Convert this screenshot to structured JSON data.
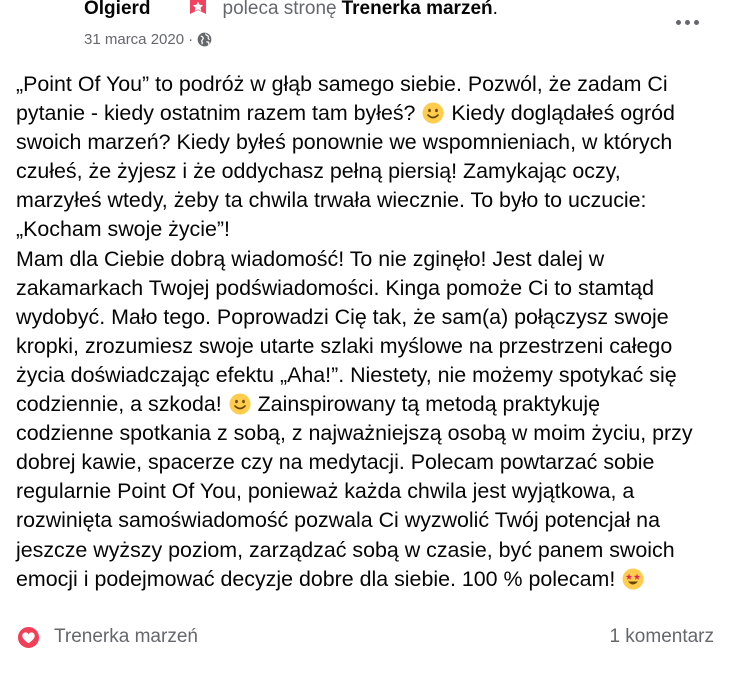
{
  "post": {
    "author": "Olgierd",
    "recommends_text": "poleca stronę",
    "page_name": "Trenerka marzeń",
    "page_name_suffix": ".",
    "date": "31 marca 2020",
    "separator": "·",
    "audience_icon": "globe-icon",
    "more_icon": "more-options-icon",
    "recommend_icon": "recommendation-flag-icon",
    "body_lines": [
      "„Point Of You” to podróż w głąb samego siebie. Pozwól, że zadam Ci",
      "pytanie - kiedy ostatnim razem tam byłeś? {smile} Kiedy doglądałeś ogród",
      "swoich marzeń? Kiedy byłeś ponownie we wspomnieniach, w których",
      "czułeś, że żyjesz i że oddychasz pełną piersią! Zamykając oczy,",
      "marzyłeś wtedy, żeby ta chwila trwała wiecznie. To było to uczucie:",
      "„Kocham swoje życie”!",
      "Mam dla Ciebie dobrą wiadomość! To nie zginęło! Jest dalej w",
      "zakamarkach Twojej podświadomości. Kinga pomoże Ci to stamtąd",
      "wydobyć. Mało tego. Poprowadzi Cię tak, że sam(a) połączysz swoje",
      "kropki, zrozumiesz swoje utarte szlaki myślowe na przestrzeni całego",
      "życia doświadczając efektu „Aha!”. Niestety, nie możemy spotykać się",
      "codziennie, a szkoda! {smile} Zainspirowany tą metodą praktykuję",
      "codzienne spotkania z sobą, z najważniejszą osobą w moim życiu, przy",
      "dobrej kawie, spacerze czy na medytacji. Polecam powtarzać sobie",
      "regularnie Point Of You, ponieważ każda chwila jest wyjątkowa, a",
      "rozwinięta samoświadomość pozwala Ci wyzwolić Twój potencjał na",
      "jeszcze wyższy poziom, zarządzać sobą w czasie, być panem swoich",
      "emocji i podejmować decyzje dobre dla siebie. 100 % polecam! {star-struck}"
    ],
    "emoji_icons": {
      "smile": "smiling-face-emoji-icon",
      "star-struck": "star-struck-emoji-icon"
    }
  },
  "footer": {
    "reaction_icon": "heart-reaction-icon",
    "reaction_name": "Trenerka marzeń",
    "comment_count": "1 komentarz"
  },
  "colors": {
    "text_primary": "#050505",
    "text_secondary": "#65676b",
    "heart_reaction": "#f33e58",
    "recommend_badge": "#f3425f",
    "emoji_yellow": "#ffcc4d"
  }
}
